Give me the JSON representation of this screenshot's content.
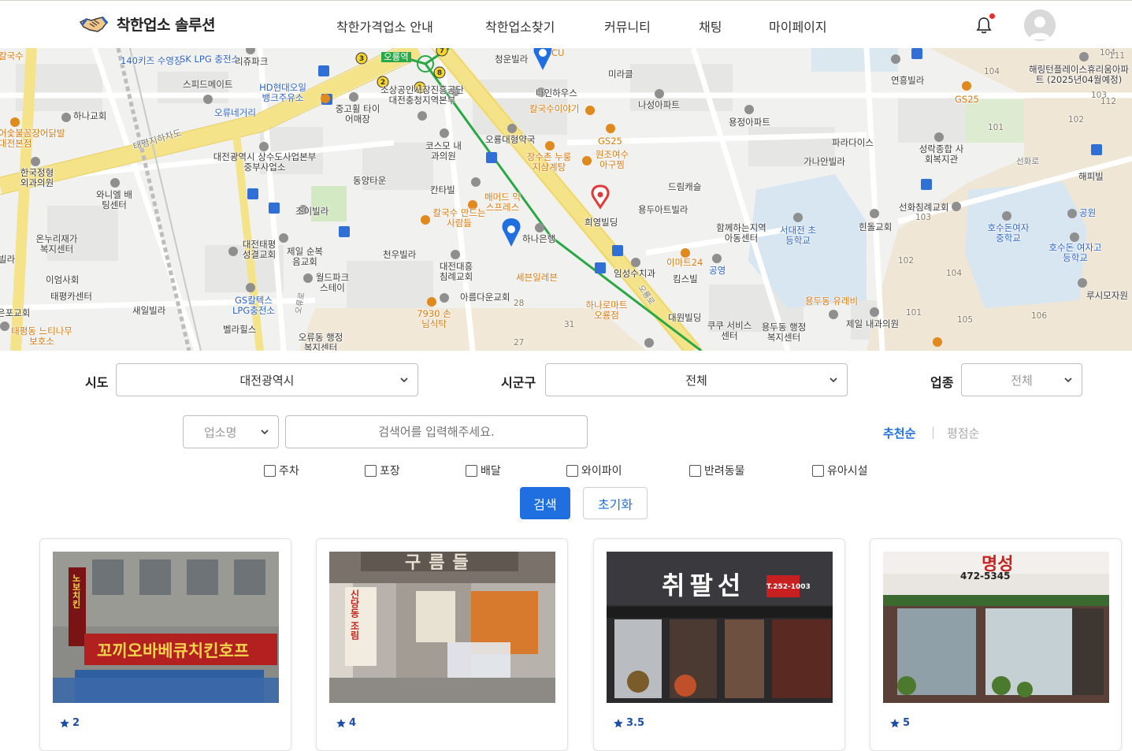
{
  "header": {
    "brand": "착한업소 솔루션",
    "nav": [
      "착한가격업소 안내",
      "착한업소찾기",
      "커뮤니티",
      "채팅",
      "마이페이지"
    ],
    "has_notification": true
  },
  "map": {
    "labels": [
      "140키즈 수영장",
      "SK LPG 충전소",
      "리쥬파크",
      "스피드메이트",
      "HD현대오일 뱅크주유소",
      "오류네거리",
      "하나교회",
      "중고휠 타이어매장",
      "소상공인시장진흥공단 대전충청지역본부",
      "오룡역",
      "청운빌라",
      "CU",
      "나인하우스",
      "칼국수이야기",
      "미라클",
      "나성아파트",
      "용정아파트",
      "연흥빌라",
      "GS25",
      "해링턴플레이스휴리움아파트 (2025년04월예정)",
      "어숯불꼼장어닭발 대전본점",
      "태평지하차도",
      "대전광역시 상수도사업본부 중부사업소",
      "코스모 내과의원",
      "오룡대형약국",
      "GS25",
      "장수촌 누룽지삼계탕",
      "원조여수 아구찜",
      "파라다이스",
      "가나안빌라",
      "성락종합 사회복지관",
      "선화로",
      "해피빌",
      "한국정형 외과의원",
      "와니엘 배팅센터",
      "동양타운",
      "칸타빌",
      "매머드 익스프레스",
      "드림캐슬",
      "희영빌딩",
      "용두아트빌라",
      "조이빌라",
      "칼국수 만드는사람들",
      "하나은행",
      "함께하는지역 아동센터",
      "서대전 초등학교",
      "선화침례교회",
      "힌돌교회",
      "호수돈여자 중학교",
      "공원",
      "호수돈 여자고등학교",
      "온누리재가 복지센터",
      "대전태평 성결교회",
      "제일 순복음교회",
      "천우빌라",
      "대전대흥 침례교회",
      "세븐일레븐",
      "임성수치과",
      "이마트24",
      "공영",
      "킴스빌",
      "이엄사회",
      "태평카센터",
      "월드파크 스테이",
      "GS칼텍스 LPG충전소",
      "아름다운교회",
      "하나로마트 오룡점",
      "대원빌딩",
      "용두동 유래비",
      "제일 내과의원",
      "루시모자원",
      "새일빌라",
      "벨라힐스",
      "오류동 행정복지센터",
      "7930 손님식탁",
      "쿠쿠 서비스센터",
      "용두동 행정복지센터",
      "태평동 느티나무보호소",
      "은포교회",
      "칼국수",
      "빌라",
      "오류로",
      "오룡로",
      "104",
      "111",
      "103",
      "112",
      "101",
      "102",
      "105",
      "106",
      "28",
      "31",
      "27",
      "1",
      "2",
      "3",
      "7",
      "8"
    ]
  },
  "filters": {
    "sido_label": "시도",
    "sido_value": "대전광역시",
    "sigungu_label": "시군구",
    "sigungu_value": "전체",
    "category_label": "업종",
    "category_value": "전체",
    "search_type": "업소명",
    "search_placeholder": "검색어를 입력해주세요.",
    "sort_recommended": "추천순",
    "sort_divider": "|",
    "sort_rating": "평점순",
    "amenities": [
      "주차",
      "포장",
      "배달",
      "와이파이",
      "반려동물",
      "유아시설"
    ],
    "search_button": "검색",
    "reset_button": "초기화"
  },
  "cards": [
    {
      "rating": "2",
      "sign_text": "꼬끼오바베큐치킨호프",
      "side_sign": "노보치킨"
    },
    {
      "rating": "4",
      "sign_text": "구름들",
      "side_sign": "신당동 조림"
    },
    {
      "rating": "3.5",
      "sign_text": "취팔선",
      "side_sign": "T.252-1003"
    },
    {
      "rating": "5",
      "sign_text": "명성",
      "side_sign": "472-5345"
    }
  ],
  "colors": {
    "primary": "#1f6fe0",
    "map_highway": "#f5e38a",
    "map_park": "#cfe8c0",
    "map_water": "#cfe4f2",
    "notification": "#ef2b2b"
  }
}
